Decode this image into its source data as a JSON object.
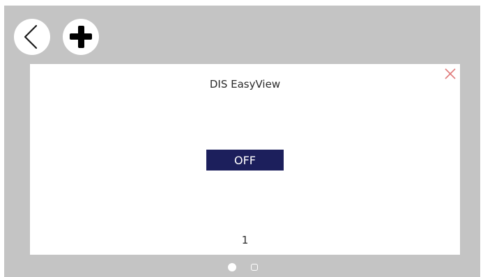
{
  "toolbar": {
    "back_icon": "chevron-left-icon",
    "add_icon": "plus-icon"
  },
  "widget": {
    "title": "DIS EasyView",
    "close_icon": "close-icon",
    "state_label": "OFF",
    "state_color": "#1c1f5c",
    "page_number": "1"
  },
  "pager": {
    "pages": 2,
    "active_index": 0
  }
}
